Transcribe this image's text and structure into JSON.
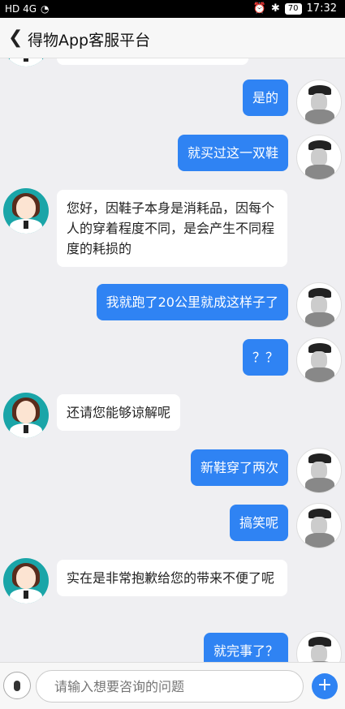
{
  "status": {
    "left_text": "HD 4G",
    "battery": "70",
    "time": "17:32"
  },
  "header": {
    "title": "得物App客服平台"
  },
  "messages": [
    {
      "from": "user",
      "text": "是的"
    },
    {
      "from": "user",
      "text": "就买过这一双鞋"
    },
    {
      "from": "agent",
      "text": "您好，因鞋子本身是消耗品，因每个人的穿着程度不同，是会产生不同程度的耗损的"
    },
    {
      "from": "user",
      "text": "我就跑了20公里就成这样子了"
    },
    {
      "from": "user",
      "text": "？？"
    },
    {
      "from": "agent",
      "text": "还请您能够谅解呢"
    },
    {
      "from": "user",
      "text": "新鞋穿了两次"
    },
    {
      "from": "user",
      "text": "搞笑呢"
    },
    {
      "from": "agent",
      "text": "实在是非常抱歉给您的带来不便了呢"
    },
    {
      "from": "user",
      "text": "就完事了？"
    }
  ],
  "input": {
    "placeholder": "请输入想要咨询的问题"
  },
  "colors": {
    "user_bubble": "#2f83f3",
    "agent_bubble": "#ffffff",
    "background": "#efeff2"
  }
}
